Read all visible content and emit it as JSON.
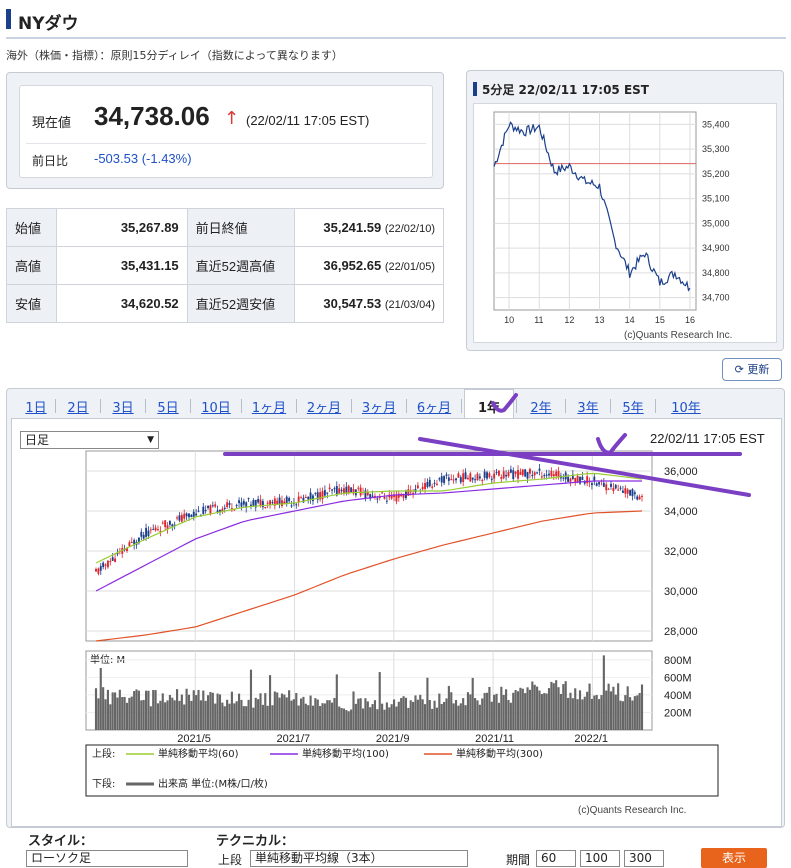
{
  "header": {
    "title": "NYダウ",
    "delay_note": "海外（株価・指標）：原則15分ディレイ（指数によって異なります）"
  },
  "quote": {
    "price_label": "現在値",
    "price": "34,738.06",
    "arrow": "↑",
    "timestamp": "(22/02/11 17:05 EST)",
    "change_label": "前日比",
    "change": "-503.53 (-1.43%)"
  },
  "stats": {
    "open_label": "始値",
    "open": "35,267.89",
    "prev_close_label": "前日終値",
    "prev_close": "35,241.59",
    "prev_close_date": "(22/02/10)",
    "high_label": "高値",
    "high": "35,431.15",
    "high52_label": "直近52週高値",
    "high52": "36,952.65",
    "high52_date": "(22/01/05)",
    "low_label": "安値",
    "low": "34,620.52",
    "low52_label": "直近52週安値",
    "low52": "30,547.53",
    "low52_date": "(21/03/04)"
  },
  "mini_chart": {
    "title": "5分足 22/02/11 17:05 EST",
    "y_ticks": [
      "35,400",
      "35,300",
      "35,200",
      "35,100",
      "35,000",
      "34,900",
      "34,800",
      "34,700"
    ],
    "x_ticks": [
      "10",
      "11",
      "12",
      "13",
      "14",
      "15",
      "16"
    ],
    "credit": "(c)Quants Research Inc."
  },
  "refresh_label": "更新",
  "tabs": [
    "1日",
    "2日",
    "3日",
    "5日",
    "10日",
    "1ヶ月",
    "2ヶ月",
    "3ヶ月",
    "6ヶ月",
    "1年",
    "2年",
    "3年",
    "5年",
    "10年"
  ],
  "selected_tab": "1年",
  "main_chart": {
    "interval_select": "日足",
    "datetime": "22/02/11 17:05 EST",
    "y_ticks": [
      "36,000",
      "34,000",
      "32,000",
      "30,000",
      "28,000"
    ],
    "vol_unit": "単位: M",
    "vol_ticks": [
      "800M",
      "600M",
      "400M",
      "200M"
    ],
    "x_ticks": [
      "2021/5",
      "2021/7",
      "2021/9",
      "2021/11",
      "2022/1"
    ],
    "legend_upper_label": "上段:",
    "legend_items": [
      "単純移動平均(60)",
      "単純移動平均(100)",
      "単純移動平均(300)"
    ],
    "legend_lower_label": "下段:",
    "legend_lower_item": "出来高 単位:(M株/口/枚)",
    "credit": "(c)Quants Research Inc."
  },
  "controls": {
    "style_label": "スタイル：",
    "style_value": "ローソク足",
    "technical_label": "テクニカル：",
    "upper_label": "上段",
    "technical_value": "単純移動平均線（3本）",
    "period_label": "期間",
    "periods": [
      "60",
      "100",
      "300"
    ],
    "show_button": "表示"
  },
  "colors": {
    "up": "#e0262d",
    "down": "#1b3f8b",
    "ma60": "#9acd32",
    "ma100": "#8a2be2",
    "ma300": "#e0532a",
    "annotation": "#7b3fc4",
    "accent": "#1b3f8b",
    "button": "#e8641d"
  },
  "chart_data": [
    {
      "type": "line",
      "title": "5分足 22/02/11 17:05 EST",
      "x": [
        9.5,
        10,
        10.5,
        11,
        11.5,
        12,
        12.5,
        13,
        13.5,
        14,
        14.5,
        15,
        15.5,
        16
      ],
      "values": [
        35230,
        35400,
        35370,
        35390,
        35210,
        35230,
        35170,
        35150,
        34930,
        34800,
        34880,
        34760,
        34800,
        34738
      ],
      "ylim": [
        34650,
        35450
      ],
      "reference_line": 35241.59
    },
    {
      "type": "line",
      "x": [
        "2021/3",
        "2021/4",
        "2021/5",
        "2021/6",
        "2021/7",
        "2021/8",
        "2021/9",
        "2021/10",
        "2021/11",
        "2021/12",
        "2022/1",
        "2022/2"
      ],
      "series": [
        {
          "name": "単純移動平均(60)",
          "values": [
            31400,
            32600,
            33700,
            34200,
            34400,
            34900,
            35000,
            35000,
            35400,
            35600,
            35900,
            35600
          ]
        },
        {
          "name": "単純移動平均(100)",
          "values": [
            30000,
            31300,
            32600,
            33500,
            34000,
            34500,
            34800,
            34900,
            35100,
            35300,
            35500,
            35500
          ]
        },
        {
          "name": "単純移動平均(300)",
          "values": [
            27500,
            27800,
            28200,
            29000,
            29800,
            30800,
            31600,
            32300,
            32900,
            33500,
            33900,
            34000
          ]
        }
      ],
      "price_close": [
        30900,
        32900,
        33900,
        34400,
        34500,
        35100,
        34600,
        35600,
        35800,
        35900,
        35500,
        34738
      ],
      "ylim": [
        27500,
        37000
      ],
      "volume_M": [
        420,
        380,
        400,
        360,
        380,
        300,
        320,
        350,
        420,
        480,
        460,
        440
      ]
    }
  ]
}
